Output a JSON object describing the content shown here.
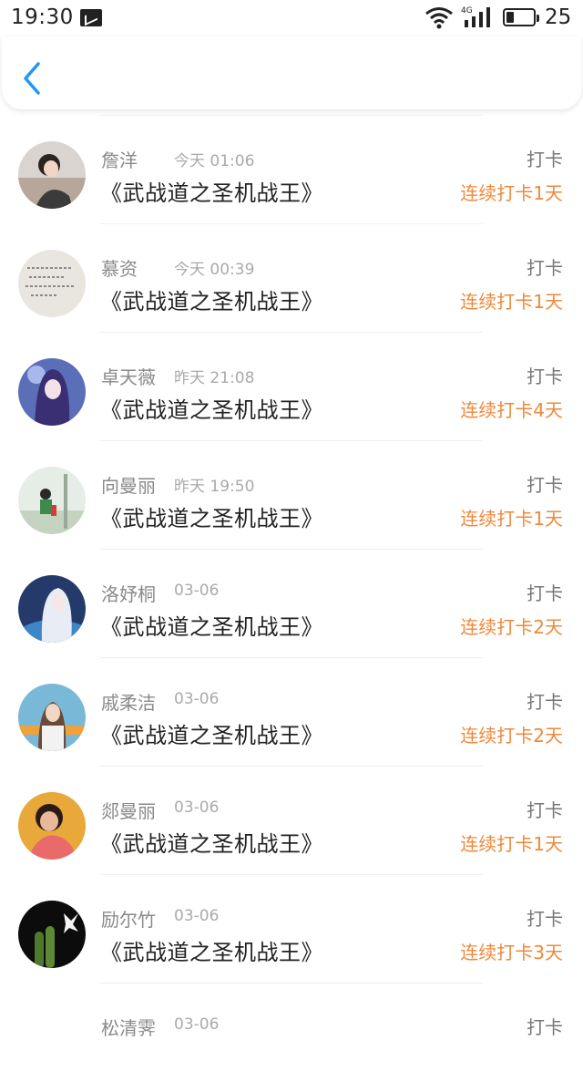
{
  "status_bar": {
    "time": "19:30",
    "battery_level": "25",
    "network": "4G"
  },
  "header": {
    "back_icon": "chevron-left-icon",
    "accent_color": "#2196f3"
  },
  "colors": {
    "streak": "#f0883a",
    "name": "#8a8a8a"
  },
  "entries": [
    {
      "name": "詹洋",
      "time": "今天 01:06",
      "title": "《武战道之圣机战王》",
      "action": "打卡",
      "streak": "连续打卡1天"
    },
    {
      "name": "慕资",
      "time": "今天 00:39",
      "title": "《武战道之圣机战王》",
      "action": "打卡",
      "streak": "连续打卡1天"
    },
    {
      "name": "卓天薇",
      "time": "昨天 21:08",
      "title": "《武战道之圣机战王》",
      "action": "打卡",
      "streak": "连续打卡4天"
    },
    {
      "name": "向曼丽",
      "time": "昨天 19:50",
      "title": "《武战道之圣机战王》",
      "action": "打卡",
      "streak": "连续打卡1天"
    },
    {
      "name": "洛妤桐",
      "time": "03-06",
      "title": "《武战道之圣机战王》",
      "action": "打卡",
      "streak": "连续打卡2天"
    },
    {
      "name": "戚柔洁",
      "time": "03-06",
      "title": "《武战道之圣机战王》",
      "action": "打卡",
      "streak": "连续打卡2天"
    },
    {
      "name": "郯曼丽",
      "time": "03-06",
      "title": "《武战道之圣机战王》",
      "action": "打卡",
      "streak": "连续打卡1天"
    },
    {
      "name": "励尔竹",
      "time": "03-06",
      "title": "《武战道之圣机战王》",
      "action": "打卡",
      "streak": "连续打卡3天"
    },
    {
      "name": "松清霁",
      "time": "03-06",
      "title": "",
      "action": "打卡",
      "streak": ""
    }
  ]
}
